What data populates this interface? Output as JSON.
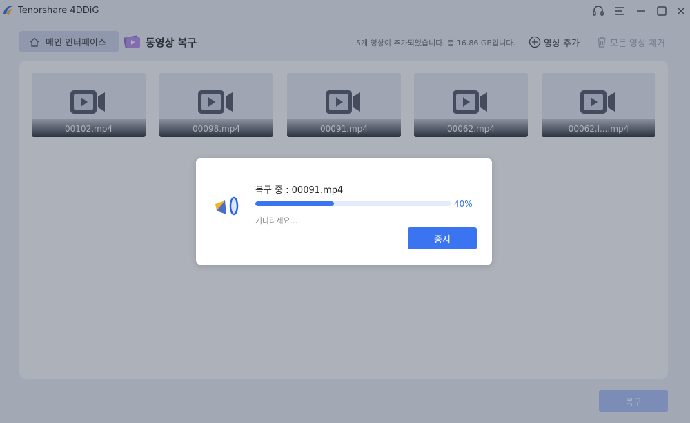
{
  "window": {
    "title": "Tenorshare 4DDiG",
    "controls": [
      "headset-icon",
      "menu-icon",
      "minimize-icon",
      "maximize-icon",
      "close-icon"
    ]
  },
  "header": {
    "home_label": "메인 인터페이스",
    "section_title": "동영상 복구",
    "status_text": "5개 영상이 추가되었습니다. 총 16.86 GB입니다.",
    "add_video_label": "영상 추가",
    "remove_all_label": "모든 영상 제거"
  },
  "videos": [
    {
      "name": "00102.mp4"
    },
    {
      "name": "00098.mp4"
    },
    {
      "name": "00091.mp4"
    },
    {
      "name": "00062.mp4"
    },
    {
      "name": "00062.l....mp4"
    }
  ],
  "footer": {
    "recover_label": "복구"
  },
  "dialog": {
    "progress_label": "복구 중 : 00091.mp4",
    "progress_value": 40,
    "progress_percent": "40%",
    "wait_text": "기다리세요...",
    "stop_label": "중지"
  },
  "colors": {
    "accent": "#3a74f0",
    "accent_disabled": "#a9c1fb",
    "overlay": "#3c4458"
  }
}
